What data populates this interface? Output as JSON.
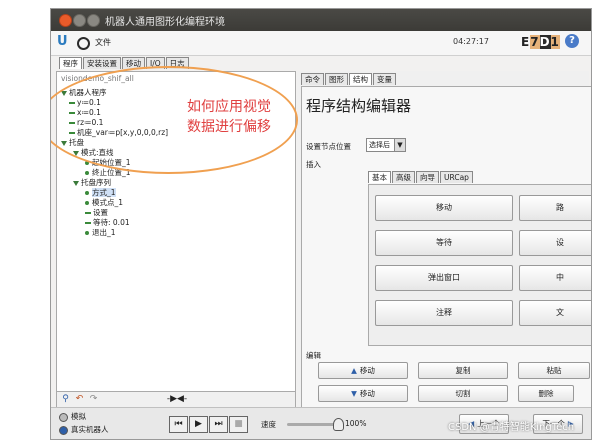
{
  "window": {
    "title": "机器人通用图形化编程环境"
  },
  "menubar": {
    "file": "文件",
    "clock": "04:27:17",
    "code": [
      "E",
      "7",
      "D",
      "1"
    ],
    "help": "?"
  },
  "main_tabs": [
    "程序",
    "安装设置",
    "移动",
    "I/O",
    "日志"
  ],
  "left_panel": {
    "header": "visiondemo_shif_all",
    "tree": [
      "机器人程序",
      "y≔0.1",
      "x≔0.1",
      "rz≔0.1",
      "机座_var≔p[x,y,0,0,0,rz]",
      "托盘",
      "模式:直线",
      "起始位置_1",
      "终止位置_1",
      "托盘序列",
      "方式_1",
      "模式点_1",
      "设置",
      "等待: 0.01",
      "退出_1"
    ],
    "bottom_arrow": "-▶◀-"
  },
  "annotation": {
    "line1": "如何应用视觉",
    "line2": "数据进行偏移"
  },
  "right_panel": {
    "tabs": [
      "命令",
      "图形",
      "结构",
      "变量"
    ],
    "title": "程序结构编辑器",
    "set_node_label": "设置节点位置",
    "set_node_value": "选择后",
    "insert_label": "插入",
    "subtabs": [
      "基本",
      "高级",
      "向导",
      "URCap"
    ],
    "buttons": [
      "移动",
      "路",
      "等待",
      "设",
      "弹出窗口",
      "中",
      "注释",
      "文"
    ],
    "edit_label": "编辑",
    "edit_buttons": [
      "移动",
      "复制",
      "粘贴",
      "移动",
      "切割",
      "删除"
    ]
  },
  "statusbar": {
    "sim": "模拟",
    "real": "真实机器人",
    "speed_label": "速度",
    "speed_value": "100%",
    "prev": "上一个",
    "next": "下一个"
  },
  "watermark": "CSDN @青特智能KingTech"
}
